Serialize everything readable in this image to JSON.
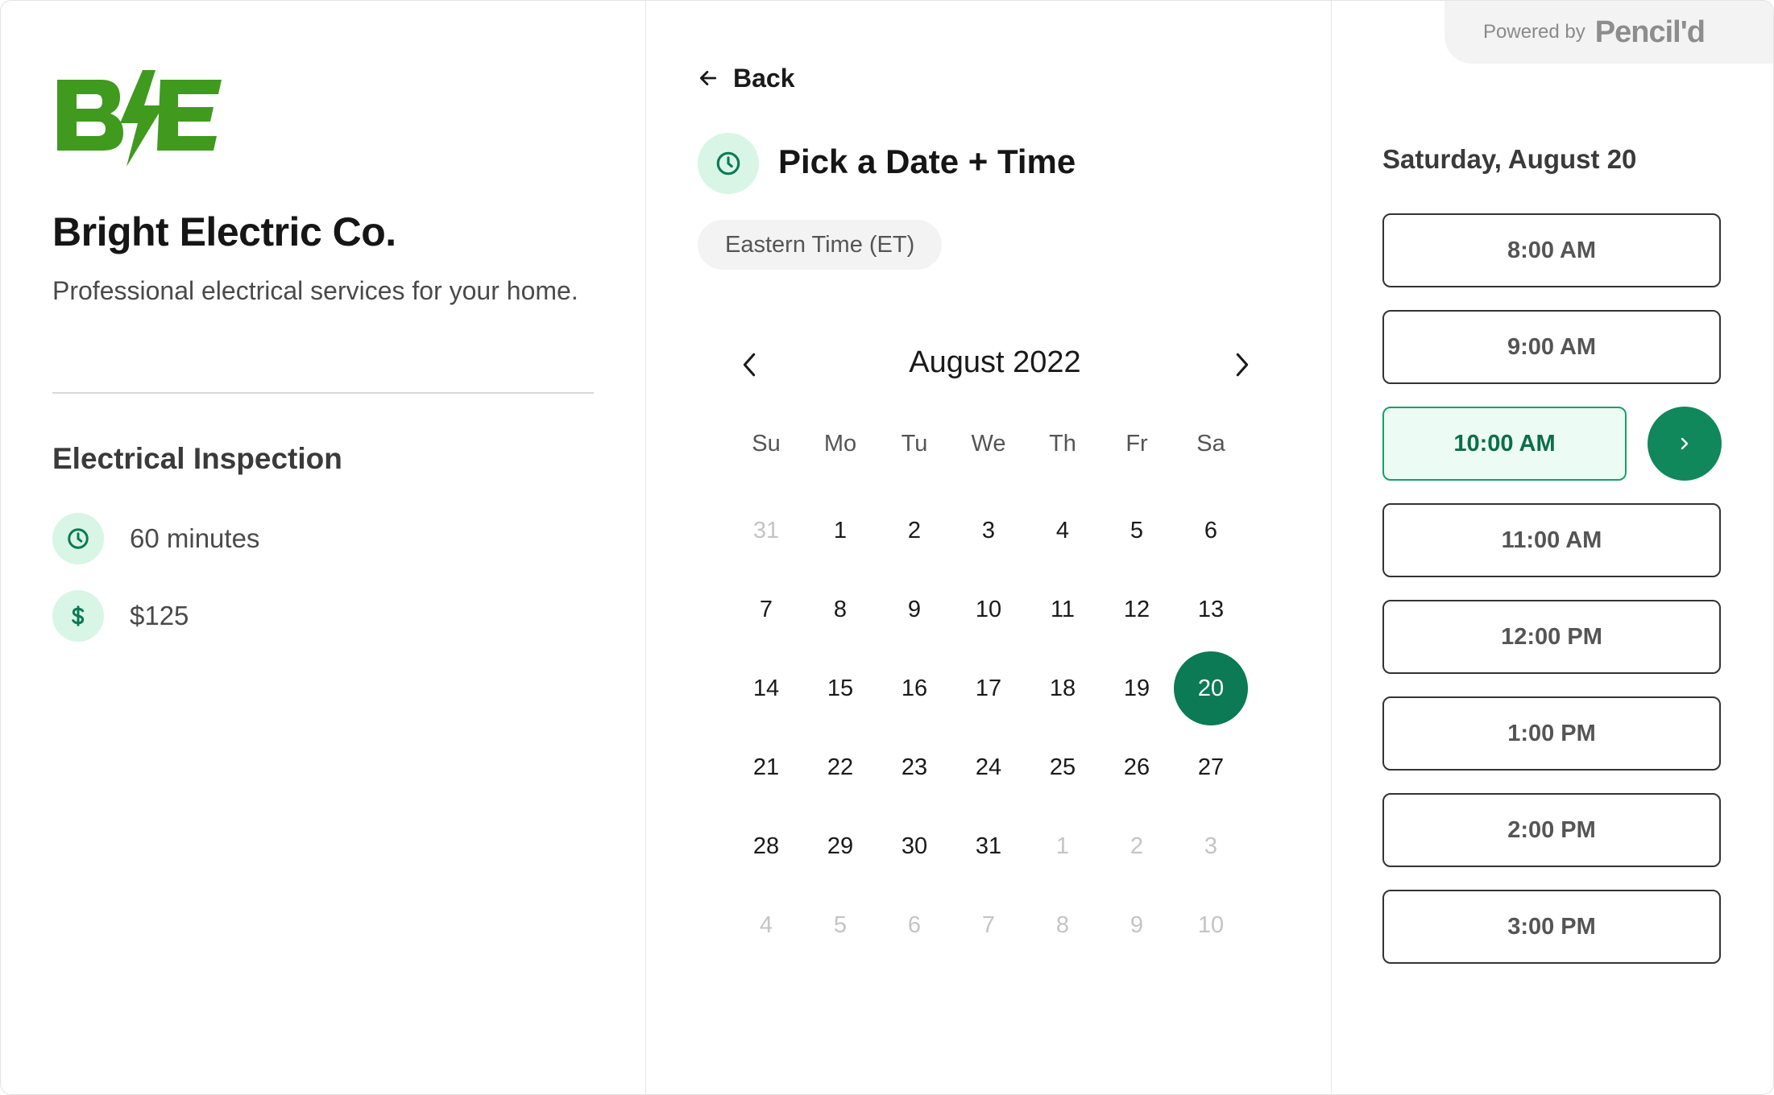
{
  "business": {
    "name": "Bright Electric Co.",
    "description": "Professional electrical services for your home."
  },
  "service": {
    "title": "Electrical Inspection",
    "duration": "60 minutes",
    "price": "$125"
  },
  "scheduler": {
    "back_label": "Back",
    "title": "Pick a Date + Time",
    "timezone": "Eastern Time (ET)"
  },
  "calendar": {
    "month_label": "August 2022",
    "weekdays": [
      "Su",
      "Mo",
      "Tu",
      "We",
      "Th",
      "Fr",
      "Sa"
    ],
    "selected_day": 20,
    "weeks": [
      [
        {
          "d": 31,
          "muted": true
        },
        {
          "d": 1
        },
        {
          "d": 2
        },
        {
          "d": 3
        },
        {
          "d": 4
        },
        {
          "d": 5
        },
        {
          "d": 6
        }
      ],
      [
        {
          "d": 7
        },
        {
          "d": 8
        },
        {
          "d": 9
        },
        {
          "d": 10
        },
        {
          "d": 11
        },
        {
          "d": 12
        },
        {
          "d": 13
        }
      ],
      [
        {
          "d": 14
        },
        {
          "d": 15
        },
        {
          "d": 16
        },
        {
          "d": 17
        },
        {
          "d": 18
        },
        {
          "d": 19
        },
        {
          "d": 20
        }
      ],
      [
        {
          "d": 21
        },
        {
          "d": 22
        },
        {
          "d": 23
        },
        {
          "d": 24
        },
        {
          "d": 25
        },
        {
          "d": 26
        },
        {
          "d": 27
        }
      ],
      [
        {
          "d": 28
        },
        {
          "d": 29
        },
        {
          "d": 30
        },
        {
          "d": 31
        },
        {
          "d": 1,
          "muted": true
        },
        {
          "d": 2,
          "muted": true
        },
        {
          "d": 3,
          "muted": true
        }
      ],
      [
        {
          "d": 4,
          "muted": true
        },
        {
          "d": 5,
          "muted": true
        },
        {
          "d": 6,
          "muted": true
        },
        {
          "d": 7,
          "muted": true
        },
        {
          "d": 8,
          "muted": true
        },
        {
          "d": 9,
          "muted": true
        },
        {
          "d": 10,
          "muted": true
        }
      ]
    ]
  },
  "times": {
    "date_heading": "Saturday, August 20",
    "slots": [
      "8:00 AM",
      "9:00 AM",
      "10:00 AM",
      "11:00 AM",
      "12:00 PM",
      "1:00 PM",
      "2:00 PM",
      "3:00 PM"
    ],
    "selected_index": 2
  },
  "powered_by": {
    "text": "Powered by",
    "brand": "Pencil'd"
  },
  "colors": {
    "brand_green": "#3f9a1e",
    "accent": "#0b7a55",
    "accent_light": "#d8f5e6"
  }
}
